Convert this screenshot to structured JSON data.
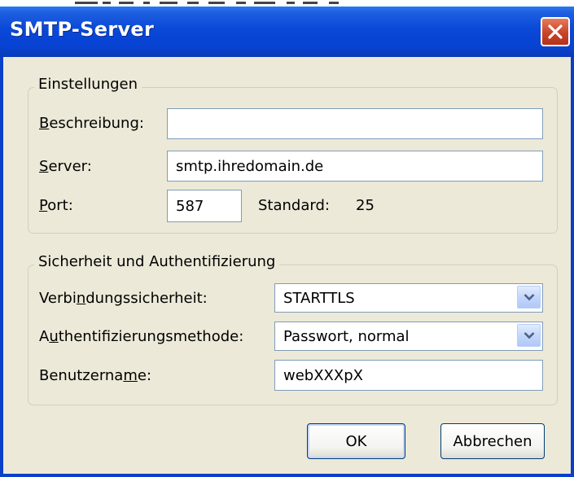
{
  "window": {
    "title": "SMTP-Server"
  },
  "settings": {
    "legend": "Einstellungen",
    "description": {
      "label_before": "",
      "label_mnemonic": "B",
      "label_after": "eschreibung:",
      "value": ""
    },
    "server": {
      "label_before": "",
      "label_mnemonic": "S",
      "label_after": "erver:",
      "value": "smtp.ihredomain.de"
    },
    "port": {
      "label_before": "",
      "label_mnemonic": "P",
      "label_after": "ort:",
      "value": "587",
      "default_label": "Standard:",
      "default_value": "25"
    }
  },
  "security": {
    "legend": "Sicherheit und Authentifizierung",
    "connection": {
      "label_before": "Verbi",
      "label_mnemonic": "n",
      "label_after": "dungssicherheit:",
      "value": "STARTTLS"
    },
    "auth": {
      "label_before": "A",
      "label_mnemonic": "u",
      "label_after": "thentifizierungsmethode:",
      "value": "Passwort, normal"
    },
    "username": {
      "label_before": "Benutzerna",
      "label_mnemonic": "m",
      "label_after": "e:",
      "value": "webXXXpX"
    }
  },
  "buttons": {
    "ok": "OK",
    "cancel": "Abbrechen"
  },
  "icons": {
    "close": "close-icon",
    "dropdown": "chevron-down-icon"
  },
  "colors": {
    "titlebar": "#0a48d8",
    "dialog_bg": "#ece9d8",
    "input_border": "#7f9db9",
    "close_button": "#c8432a"
  }
}
